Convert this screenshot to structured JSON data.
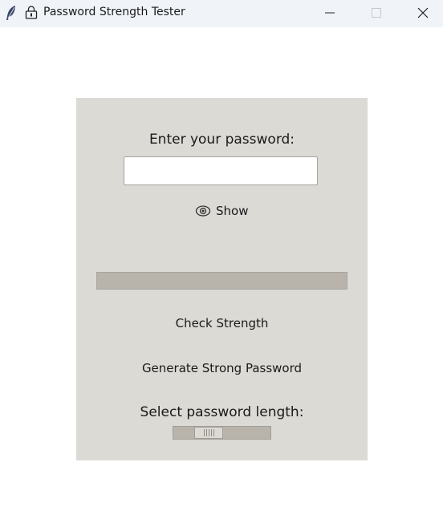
{
  "window": {
    "title": "Password Strength Tester"
  },
  "form": {
    "prompt": "Enter your password:",
    "password_value": "",
    "show_label": "Show",
    "check_label": "Check Strength",
    "generate_label": "Generate Strong Password",
    "length_label": "Select password length:"
  },
  "strength": {
    "level": 0
  },
  "slider": {
    "position": 0.3
  },
  "colors": {
    "panel": "#dcdad5",
    "bar": "#b8b4ac",
    "titlebar": "#f0f4f9"
  },
  "icons": {
    "app": "feather-icon",
    "title": "lock-icon",
    "show": "eye-icon",
    "minimize": "minimize-icon",
    "maximize": "maximize-icon",
    "close": "close-icon"
  }
}
